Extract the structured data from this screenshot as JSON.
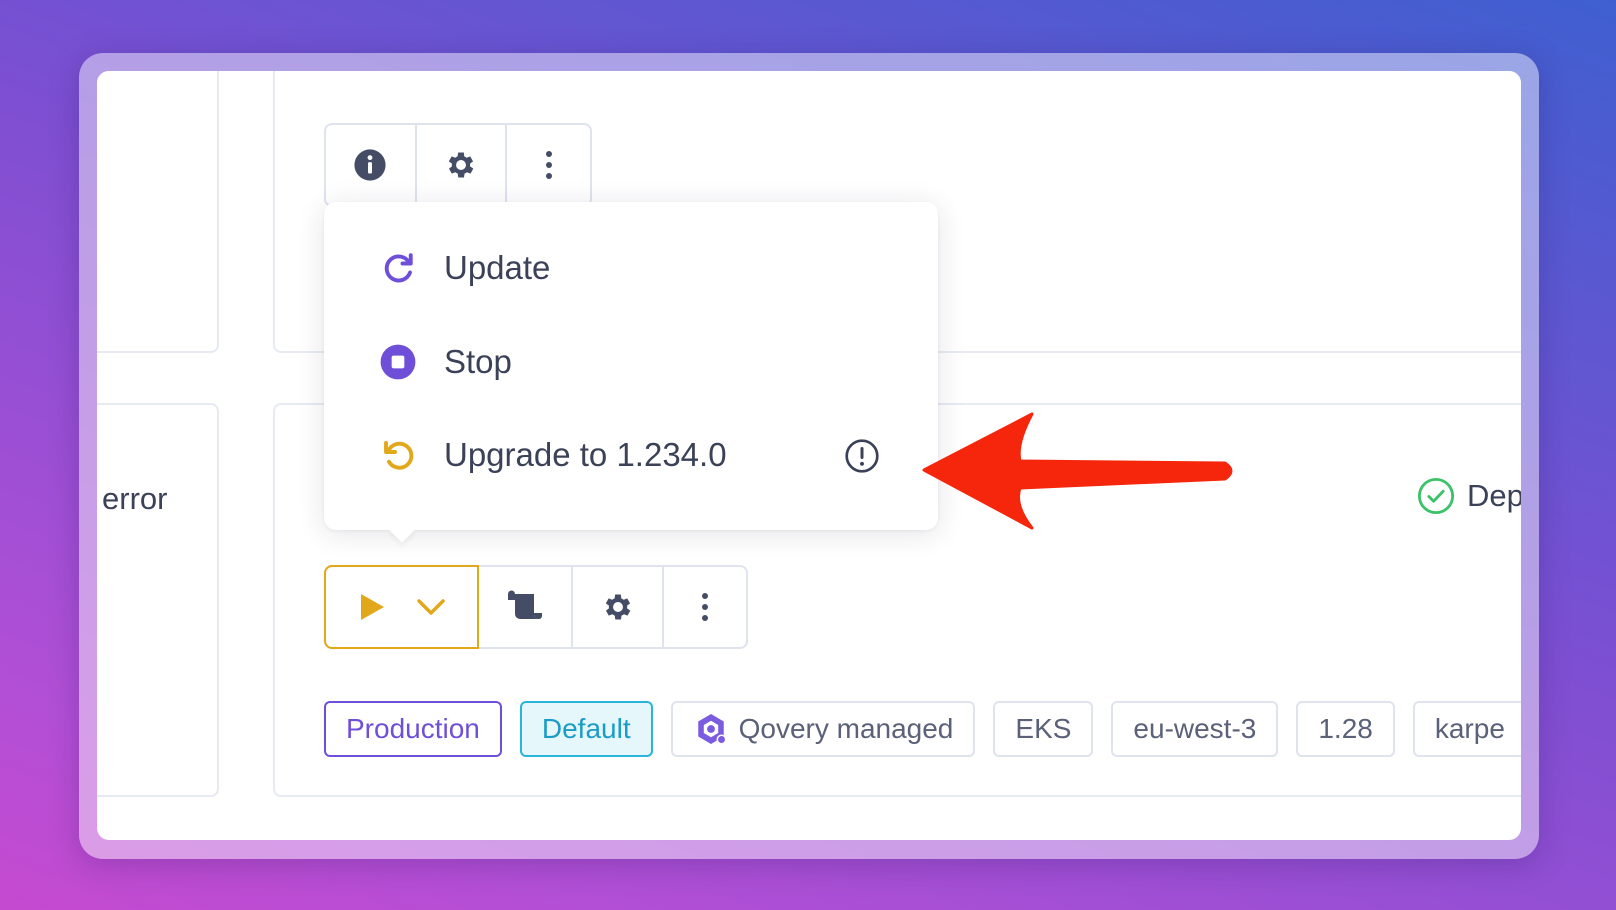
{
  "left_card": {
    "status_text": "error"
  },
  "right_card": {
    "status_text": "Dep"
  },
  "top_actions": {
    "icons": [
      "info-icon",
      "gear-icon",
      "more-vertical-icon"
    ]
  },
  "dropdown": {
    "items": [
      {
        "label": "Update",
        "icon": "refresh-icon",
        "color": "#6f4fd8"
      },
      {
        "label": "Stop",
        "icon": "stop-circle-icon",
        "color": "#6f4fd8"
      },
      {
        "label": "Upgrade to 1.234.0",
        "icon": "undo-icon",
        "color": "#e2a81b",
        "trailing_icon": "exclamation-circle-icon"
      }
    ]
  },
  "bottom_actions": {
    "icons": [
      "play-icon",
      "chevron-down-icon",
      "scroll-logs-icon",
      "gear-icon",
      "more-vertical-icon"
    ],
    "accent": "#e2a81b"
  },
  "tags": [
    {
      "label": "Production"
    },
    {
      "label": "Default"
    },
    {
      "label": "Qovery managed",
      "icon": "qovery-logo-icon"
    },
    {
      "label": "EKS"
    },
    {
      "label": "eu-west-3"
    },
    {
      "label": "1.28"
    },
    {
      "label": "karpe"
    }
  ],
  "annotation": {
    "arrow_color": "#f5260b"
  },
  "colors": {
    "accent_purple": "#6f4fd8",
    "accent_yellow": "#e2a81b",
    "success_green": "#3cc26b"
  }
}
